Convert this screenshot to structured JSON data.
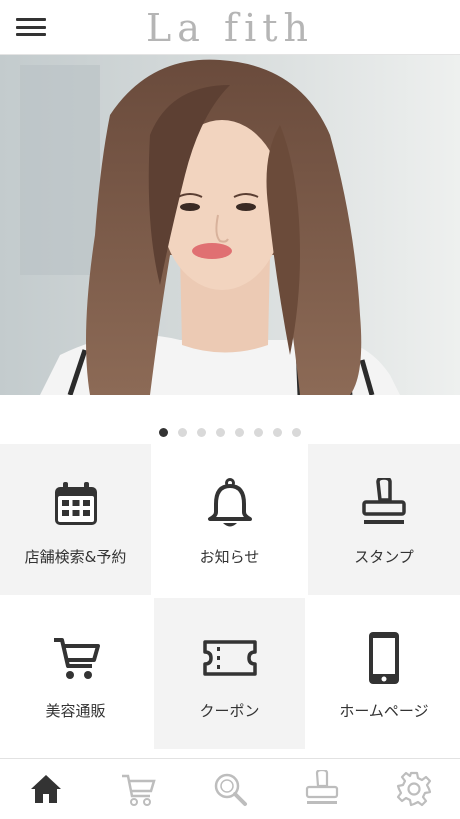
{
  "header": {
    "logo_text": "La fith",
    "menu_icon": "hamburger-menu-icon"
  },
  "carousel": {
    "slide_count": 8,
    "active_index": 0
  },
  "menu_tiles": [
    {
      "label": "店舗検索&予約",
      "icon": "calendar-icon"
    },
    {
      "label": "お知らせ",
      "icon": "bell-icon"
    },
    {
      "label": "スタンプ",
      "icon": "stamp-icon"
    },
    {
      "label": "美容通販",
      "icon": "cart-icon"
    },
    {
      "label": "クーポン",
      "icon": "ticket-icon"
    },
    {
      "label": "ホームページ",
      "icon": "smartphone-icon"
    }
  ],
  "tabbar": {
    "items": [
      {
        "icon": "home-icon",
        "active": true
      },
      {
        "icon": "cart-icon",
        "active": false
      },
      {
        "icon": "search-icon",
        "active": false
      },
      {
        "icon": "stamp-icon",
        "active": false
      },
      {
        "icon": "gear-icon",
        "active": false
      }
    ]
  },
  "colors": {
    "icon_dark": "#333333",
    "icon_inactive": "#bdbdbd",
    "tile_gray": "#f3f3f3",
    "logo": "#b5b5b5"
  }
}
